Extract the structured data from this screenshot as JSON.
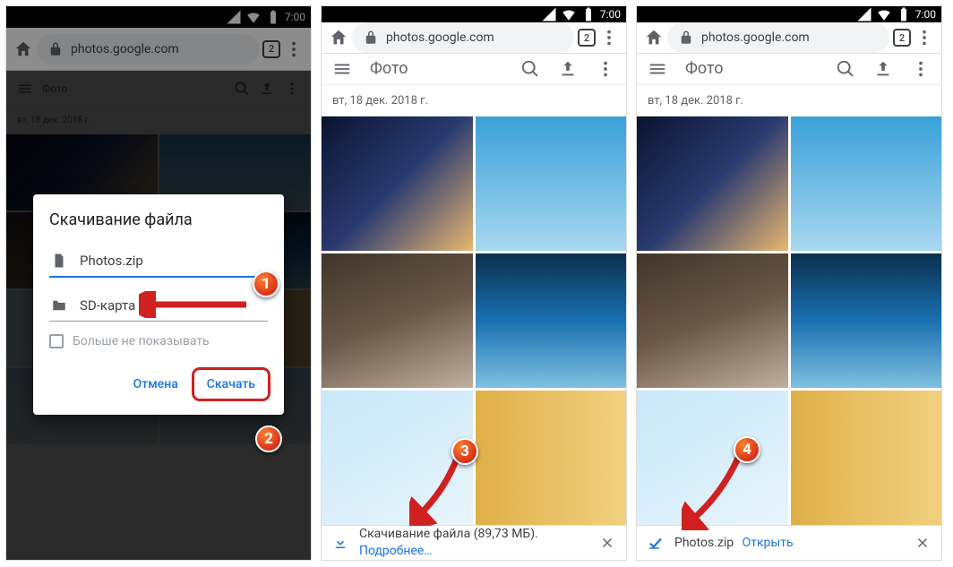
{
  "status": {
    "time": "7:00"
  },
  "browser": {
    "url": "photos.google.com",
    "tab_count": "2"
  },
  "app": {
    "title": "Фото",
    "date": "вт, 18 дек. 2018 г."
  },
  "dialog": {
    "title": "Скачивание файла",
    "filename": "Photos.zip",
    "location": "SD-карта",
    "dont_show": "Больше не показывать",
    "cancel": "Отмена",
    "download": "Скачать"
  },
  "download_bar": {
    "progress_text": "Скачивание файла (89,73 МБ).",
    "more": "Подробнее…",
    "done_file": "Photos.zip",
    "open": "Открыть"
  },
  "steps": {
    "s1": "1",
    "s2": "2",
    "s3": "3",
    "s4": "4"
  }
}
